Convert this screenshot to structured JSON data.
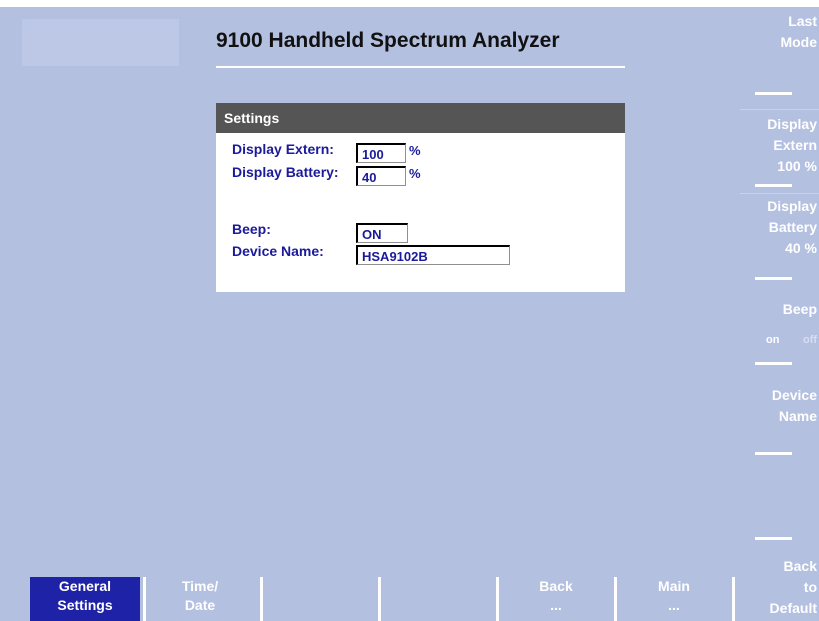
{
  "header": {
    "title": "9100 Handheld Spectrum Analyzer"
  },
  "settings": {
    "heading": "Settings",
    "display_extern_label": "Display Extern:",
    "display_extern_value": "100",
    "display_extern_unit": "%",
    "display_battery_label": "Display Battery:",
    "display_battery_value": "40",
    "display_battery_unit": "%",
    "beep_label": "Beep:",
    "beep_value": "ON",
    "device_name_label": "Device Name:",
    "device_name_value": "HSA9102B"
  },
  "softkeys_right": {
    "last_mode": [
      "Last",
      "Mode"
    ],
    "display_extern": [
      "Display",
      "Extern",
      "100 %"
    ],
    "display_battery": [
      "Display",
      "Battery",
      "40 %"
    ],
    "beep": {
      "label": "Beep",
      "on": "on",
      "off": "off"
    },
    "device_name": [
      "Device",
      "Name"
    ],
    "back_to_default": [
      "Back",
      "to",
      "Default"
    ]
  },
  "softkeys_bottom": [
    {
      "line1": "General",
      "line2": "Settings",
      "active": true
    },
    {
      "line1": "Time/",
      "line2": "Date",
      "active": false
    },
    {
      "line1": "",
      "line2": "",
      "active": false
    },
    {
      "line1": "",
      "line2": "",
      "active": false
    },
    {
      "line1": "Back",
      "line2": "...",
      "active": false
    },
    {
      "line1": "Main",
      "line2": "...",
      "active": false
    }
  ],
  "colors": {
    "background": "#b4c0e0",
    "active_softkey": "#1e22a6",
    "panel_header": "#555555",
    "field_text": "#1a1a9a"
  }
}
